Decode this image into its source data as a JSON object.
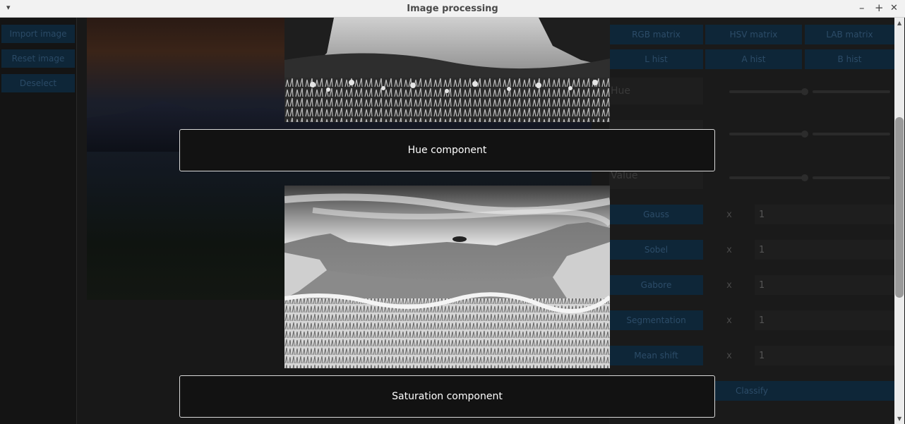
{
  "window": {
    "title": "Image processing",
    "menu_glyph": "▾",
    "minimize_glyph": "–",
    "maximize_glyph": "+",
    "close_glyph": "✕"
  },
  "left_panel": {
    "buttons": [
      "Import image",
      "Reset image",
      "Deselect"
    ]
  },
  "right_panel": {
    "matrix_buttons": [
      "RGB matrix",
      "HSV matrix",
      "LAB matrix"
    ],
    "hist_buttons": [
      "L hist",
      "A hist",
      "B hist"
    ],
    "sliders": [
      {
        "label": "Hue"
      },
      {
        "label": ""
      },
      {
        "label": "Value"
      }
    ],
    "filters": [
      {
        "label": "Gauss",
        "x": "x",
        "value": "1"
      },
      {
        "label": "Sobel",
        "x": "x",
        "value": "1"
      },
      {
        "label": "Gabore",
        "x": "x",
        "value": "1"
      },
      {
        "label": "Segmentation",
        "x": "x",
        "value": "1"
      },
      {
        "label": "Mean shift",
        "x": "x",
        "value": "1"
      }
    ],
    "classify_button": "Classify"
  },
  "dialog": {
    "hue_caption": "Hue component",
    "saturation_caption": "Saturation component"
  },
  "colors": {
    "accent_button": "#0e2638",
    "caption_border": "#d9d9d9"
  }
}
